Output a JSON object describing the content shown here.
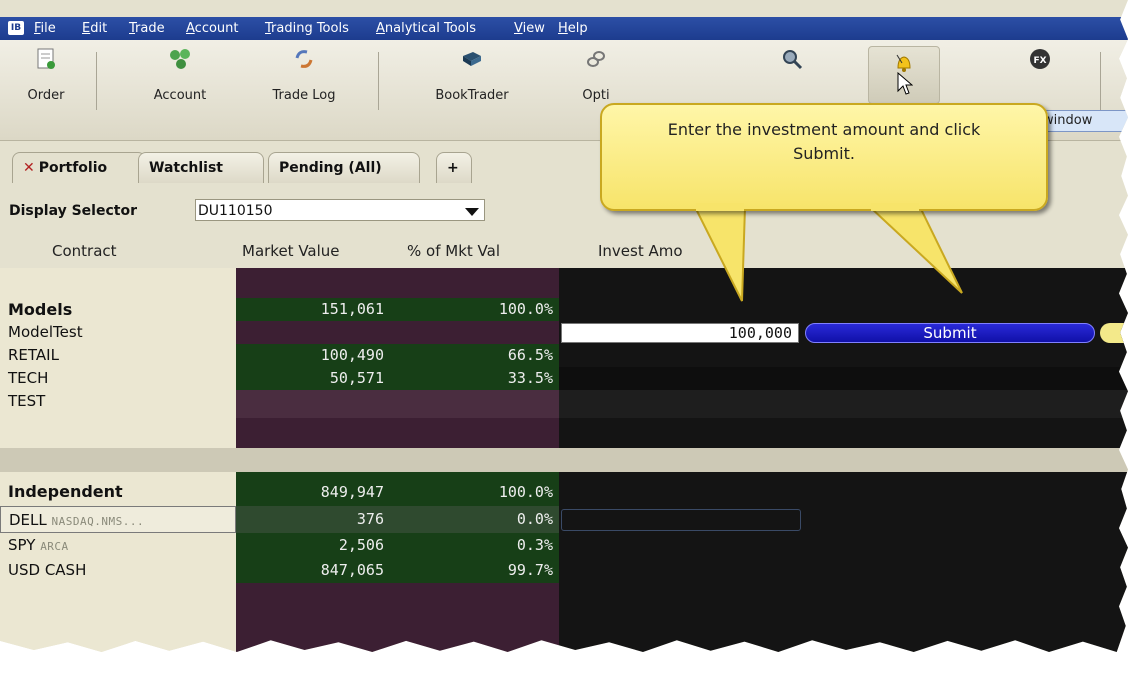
{
  "menu": {
    "logo": "IB",
    "items": [
      "File",
      "Edit",
      "Trade",
      "Account",
      "Trading Tools",
      "Analytical Tools",
      "View",
      "Help"
    ]
  },
  "toolbar": {
    "buttons": [
      {
        "label": "Order",
        "icon": "order-icon"
      },
      {
        "label": "Account",
        "icon": "account-icon"
      },
      {
        "label": "Trade Log",
        "icon": "trade-log-icon"
      },
      {
        "label": "BookTrader",
        "icon": "booktrader-icon"
      },
      {
        "label": "Opti",
        "icon": "option-icon"
      },
      {
        "label": "",
        "icon": "search-icon"
      },
      {
        "label": "",
        "icon": "alert-bell-icon"
      },
      {
        "label": "",
        "icon": "fx-icon"
      }
    ],
    "window_tag": "window"
  },
  "tabs": [
    {
      "label": "Portfolio",
      "close": "✕"
    },
    {
      "label": "Watchlist"
    },
    {
      "label": "Pending (All)"
    },
    {
      "label": "+"
    }
  ],
  "display_selector": {
    "label": "Display Selector",
    "value": "DU110150"
  },
  "columns": {
    "contract": "Contract",
    "market_value": "Market Value",
    "pct_mkt_val": "% of Mkt Val",
    "invest_amount": "Invest Amo"
  },
  "rows": [
    {
      "contract": "",
      "exchange": "",
      "mv": "",
      "pct": ""
    },
    {
      "contract": "Models",
      "exchange": "",
      "mv": "151,061",
      "pct": "100.0%"
    },
    {
      "contract": "ModelTest",
      "exchange": "",
      "mv": "",
      "pct": ""
    },
    {
      "contract": "RETAIL",
      "exchange": "",
      "mv": "100,490",
      "pct": "66.5%"
    },
    {
      "contract": "TECH",
      "exchange": "",
      "mv": "50,571",
      "pct": "33.5%"
    },
    {
      "contract": "TEST",
      "exchange": "",
      "mv": "",
      "pct": ""
    },
    {
      "contract": "",
      "exchange": "",
      "mv": "",
      "pct": ""
    },
    {
      "contract": "",
      "exchange": "",
      "mv": "",
      "pct": ""
    },
    {
      "contract": "Independent",
      "exchange": "",
      "mv": "849,947",
      "pct": "100.0%"
    },
    {
      "contract": "DELL",
      "exchange": "NASDAQ.NMS...",
      "mv": "376",
      "pct": "0.0%"
    },
    {
      "contract": "SPY",
      "exchange": "ARCA",
      "mv": "2,506",
      "pct": "0.3%"
    },
    {
      "contract": "USD CASH",
      "exchange": "",
      "mv": "847,065",
      "pct": "99.7%"
    }
  ],
  "invest": {
    "amount": "100,000",
    "submit_label": "Submit"
  },
  "callout": {
    "line1": "Enter the investment amount and click",
    "line2": "Submit."
  },
  "colors": {
    "menubar": "#1d3c8e",
    "green_cell": "#173f17",
    "purple_cell": "#3c1f33",
    "submit": "#1010a8",
    "callout": "#f7e46a"
  }
}
